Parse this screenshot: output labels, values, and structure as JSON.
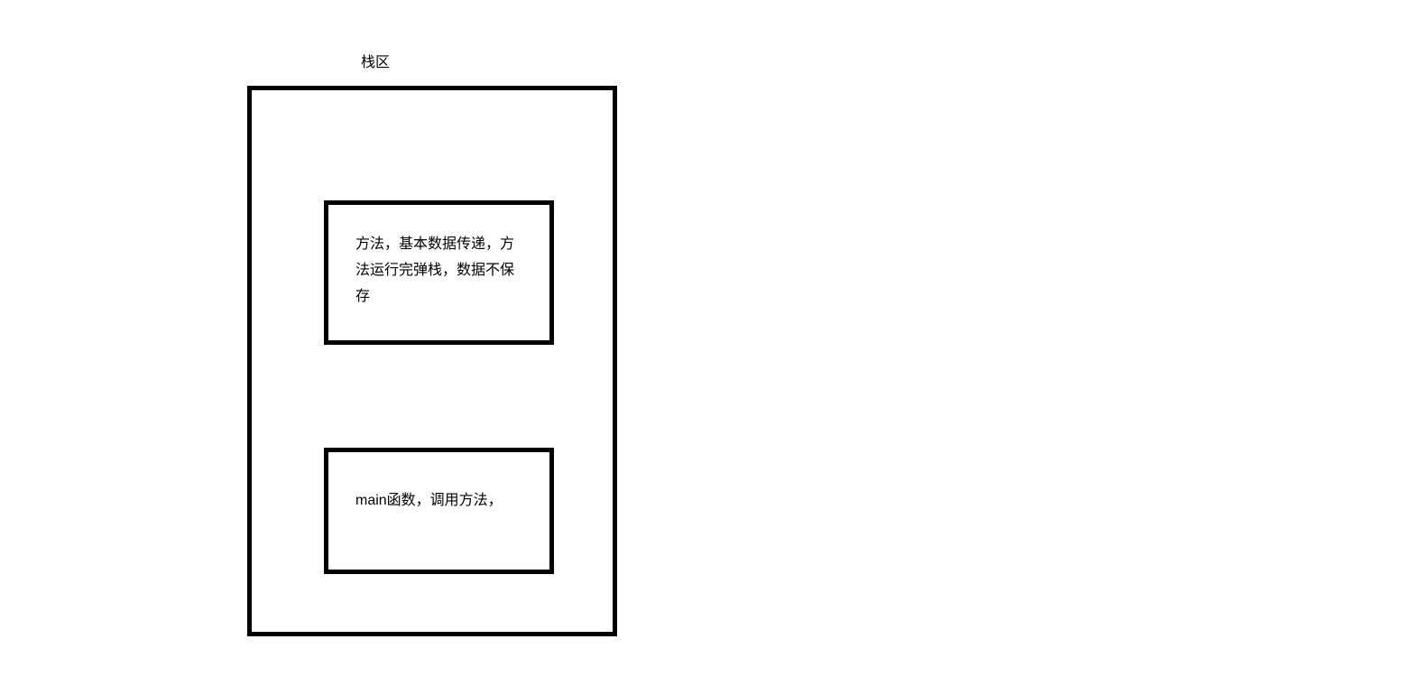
{
  "diagram": {
    "title": "栈区",
    "method_frame": {
      "text": "方法，基本数据传递，方法运行完弹栈，数据不保存"
    },
    "main_frame": {
      "text": "main函数，调用方法，"
    }
  }
}
